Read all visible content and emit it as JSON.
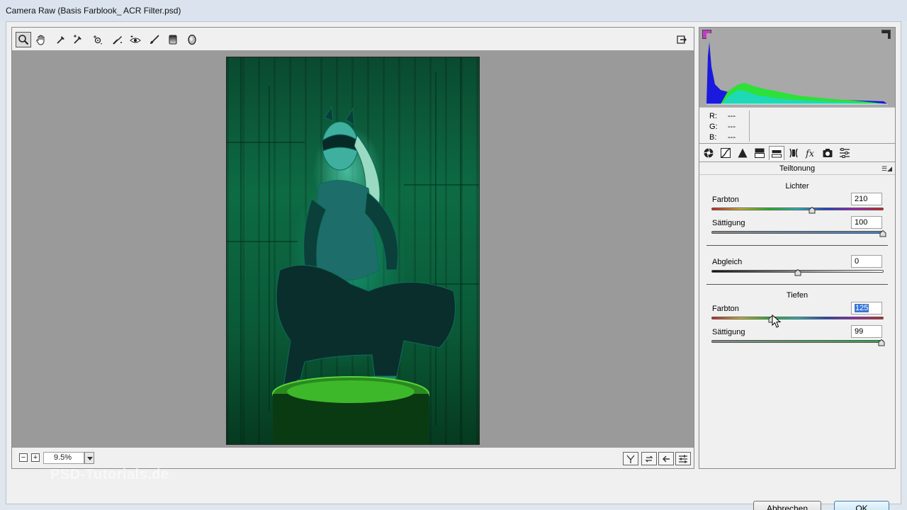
{
  "window": {
    "title": "Camera Raw (Basis Farblook_ ACR Filter.psd)"
  },
  "toolbar": {
    "tools": [
      "zoom-icon",
      "hand-icon",
      "white-balance-icon",
      "color-sampler-icon",
      "targeted-adjustment-icon",
      "spot-removal-icon",
      "red-eye-icon",
      "adjustment-brush-icon",
      "graduated-filter-icon",
      "radial-filter-icon"
    ],
    "open_preferences_icon": "toggle-fullscreen-icon"
  },
  "rgb_readout": {
    "r_label": "R:",
    "r_value": "---",
    "g_label": "G:",
    "g_value": "---",
    "b_label": "B:",
    "b_value": "---"
  },
  "panel": {
    "title": "Teiltonung",
    "highlights": {
      "title": "Lichter",
      "hue_label": "Farbton",
      "hue_value": "210",
      "hue": 210,
      "sat_label": "Sättigung",
      "sat_value": "100",
      "sat": 100
    },
    "balance": {
      "label": "Abgleich",
      "value": "0",
      "level": 0
    },
    "shadows": {
      "title": "Tiefen",
      "hue_label": "Farbton",
      "hue_value": "125",
      "hue": 125,
      "sat_label": "Sättigung",
      "sat_value": "99",
      "sat": 99
    }
  },
  "status": {
    "zoom_value": "9.5%"
  },
  "watermark": "PSD-Tutorials.de",
  "buttons": {
    "cancel": "Abbrechen",
    "ok": "OK"
  },
  "colors": {
    "accent": "#3875d7",
    "image_tint": "#0d6b44"
  }
}
